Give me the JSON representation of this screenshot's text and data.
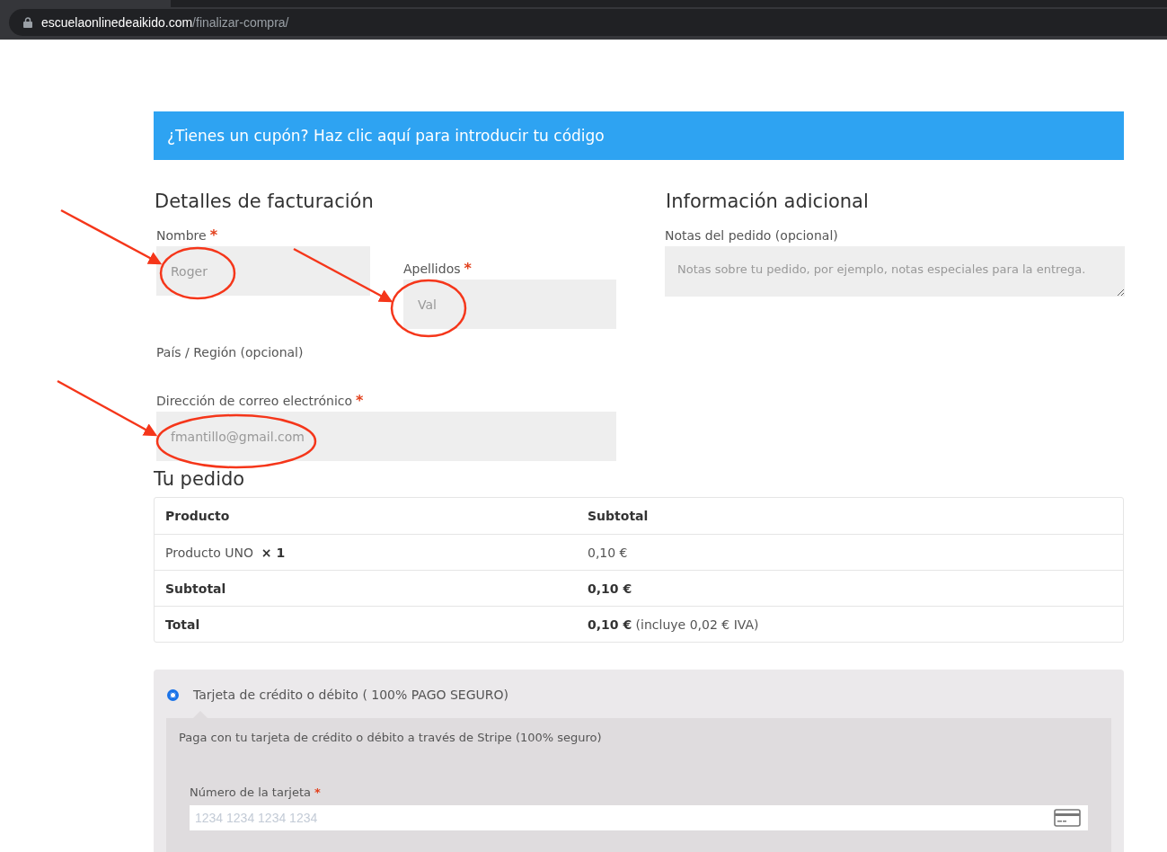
{
  "browser": {
    "domain": "escuelaonlinedeaikido.com",
    "path": "/finalizar-compra/"
  },
  "coupon_notice": "¿Tienes un cupón? Haz clic aquí para introducir tu código",
  "billing": {
    "heading": "Detalles de facturación",
    "fields": [
      {
        "kind": "input",
        "label": "Nombre",
        "required_mark": "*",
        "placeholder": "Roger"
      },
      {
        "kind": "input",
        "label": "Apellidos",
        "required_mark": "*",
        "placeholder": "Val"
      },
      {
        "kind": "select",
        "label": "País / Región (opcional)"
      },
      {
        "kind": "input",
        "label": "Dirección de correo electrónico",
        "required_mark": "*",
        "placeholder": "fmantillo@gmail.com"
      }
    ]
  },
  "additional": {
    "heading": "Información adicional",
    "label": "Notas del pedido (opcional)",
    "placeholder": "Notas sobre tu pedido, por ejemplo, notas especiales para la entrega."
  },
  "order": {
    "heading": "Tu pedido",
    "columns": [
      "Producto",
      "Subtotal"
    ],
    "rows": [
      {
        "kind": "item",
        "product": "Producto UNO",
        "quantity": "× 1",
        "amount": "0,10 €"
      },
      {
        "kind": "total",
        "product": "Subtotal",
        "amount": "**0,10 €**"
      },
      {
        "kind": "total",
        "product": "Total",
        "amount": "**0,10 €** (incluye 0,02 € IVA)"
      }
    ]
  },
  "payment": {
    "methods": [
      {
        "label": "Tarjeta de crédito o débito ( 100% PAGO SEGURO)",
        "selected": true
      }
    ],
    "description": "Paga con tu tarjeta de crédito o débito a través de Stripe (100% seguro)",
    "card_label": "Número de la tarjeta",
    "required_mark": "*",
    "card_placeholder": "1234 1234 1234 1234"
  }
}
